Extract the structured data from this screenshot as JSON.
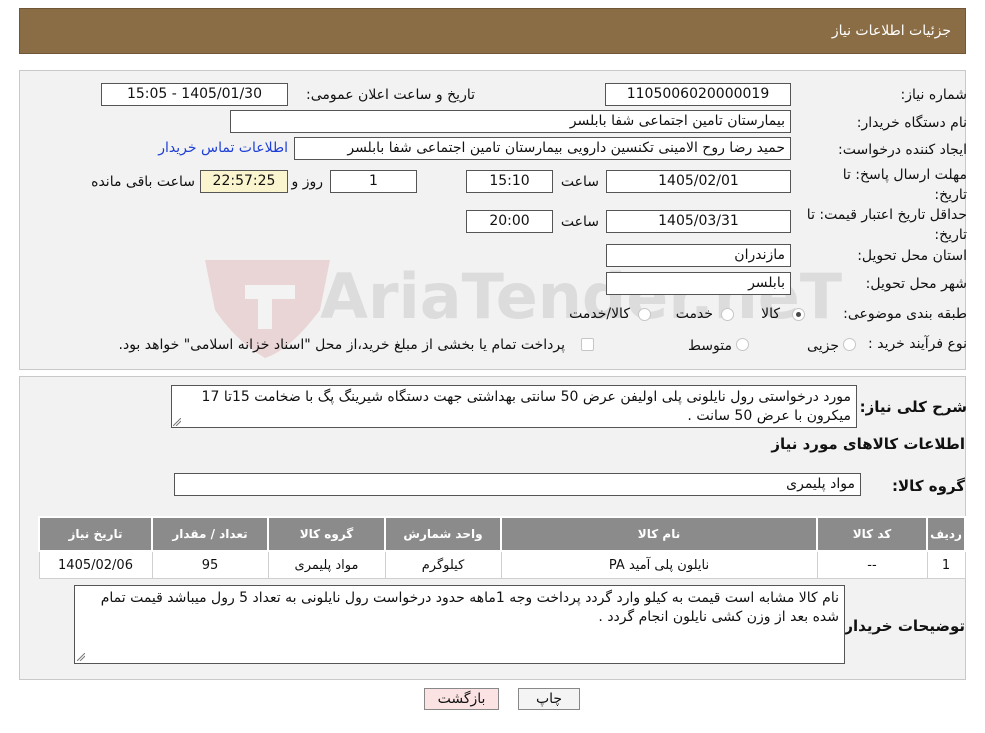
{
  "header": {
    "title": "جزئیات اطلاعات نیاز"
  },
  "watermark": {
    "text": "AriaTender.neT"
  },
  "form": {
    "need_number_label": "شماره نیاز:",
    "need_number": "1105006020000019",
    "announce_label": "تاریخ و ساعت اعلان عمومی:",
    "announce_value": "1405/01/30 - 15:05",
    "buyer_org_label": "نام دستگاه خریدار:",
    "buyer_org": "بیمارستان تامین اجتماعی شفا بابلسر",
    "creator_label": "ایجاد کننده درخواست:",
    "creator": "حمید رضا روح الامینی تکنسین دارویی بیمارستان تامین اجتماعی شفا بابلسر",
    "contact_link": "اطلاعات تماس خریدار",
    "reply_deadline_label": "مهلت ارسال پاسخ: تا تاریخ:",
    "reply_date": "1405/02/01",
    "time_label": "ساعت",
    "reply_time": "15:10",
    "days_value": "1",
    "days_label": "روز و",
    "remaining_value": "22:57:25",
    "remaining_label": "ساعت باقی مانده",
    "validity_label": "حداقل تاریخ اعتبار قیمت: تا تاریخ:",
    "validity_date": "1405/03/31",
    "validity_time": "20:00",
    "province_label": "استان محل تحویل:",
    "province": "مازندران",
    "city_label": "شهر محل تحویل:",
    "city": "بابلسر",
    "category_label": "طبقه بندی موضوعی:",
    "category_options": [
      "کالا",
      "خدمت",
      "کالا/خدمت"
    ],
    "category_selected": "کالا",
    "purchase_type_label": "نوع فرآیند خرید :",
    "purchase_options": [
      "جزیی",
      "متوسط"
    ],
    "purchase_note": "پرداخت تمام یا بخشی از مبلغ خرید،از محل \"اسناد خزانه اسلامی\" خواهد بود."
  },
  "description": {
    "label": "شرح کلی نیاز:",
    "text": "مورد درخواستی رول نایلونی پلی اولیفن عرض 50 سانتی بهداشتی جهت دستگاه شیرینگ پگ با ضخامت 15تا 17 میکرون با عرض 50 سانت ."
  },
  "goods": {
    "section_title": "اطلاعات کالاهای مورد نیاز",
    "group_label": "گروه کالا:",
    "group_value": "مواد پلیمری",
    "columns": [
      "ردیف",
      "کد کالا",
      "نام کالا",
      "واحد شمارش",
      "گروه کالا",
      "تعداد / مقدار",
      "تاریخ نیاز"
    ],
    "rows": [
      [
        "1",
        "--",
        "نایلون پلی آمید PA",
        "کیلوگرم",
        "مواد پلیمری",
        "95",
        "1405/02/06"
      ]
    ]
  },
  "buyer_notes": {
    "label": "توضیحات خریدار:",
    "text": "نام کالا مشابه است قیمت به کیلو وارد گردد پرداخت وجه 1ماهه حدود درخواست رول نایلونی به تعداد 5 رول میباشد قیمت تمام شده بعد از وزن کشی نایلون انجام گردد ."
  },
  "buttons": {
    "print": "چاپ",
    "back": "بازگشت"
  }
}
